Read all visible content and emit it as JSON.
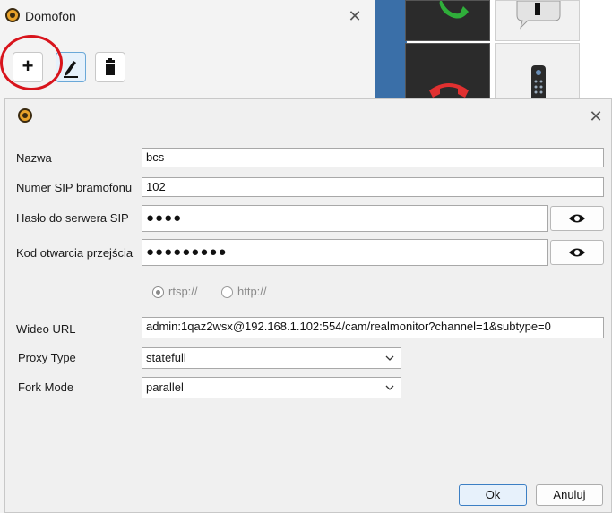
{
  "background_window": {
    "title": "Domofon",
    "close_glyph": "✕",
    "toolbar": {
      "add_glyph": "+",
      "add_icon": "plus-icon",
      "edit_icon": "pencil-icon",
      "delete_icon": "trash-icon"
    }
  },
  "side_tiles": {
    "icons": [
      "phone-answer-icon",
      "chat-bubble-icon",
      "phone-hangup-icon",
      "intercom-panel-icon"
    ]
  },
  "dialog": {
    "close_glyph": "✕",
    "fields": {
      "name_label": "Nazwa",
      "name_value": "bcs",
      "sip_label": "Numer SIP bramofonu",
      "sip_value": "102",
      "password_label": "Hasło do serwera SIP",
      "password_value": "●●●●",
      "code_label": "Kod otwarcia przejścia",
      "code_value": "●●●●●●●●●",
      "video_label": "Wideo URL",
      "video_value": "admin:1qaz2wsx@192.168.1.102:554/cam/realmonitor?channel=1&subtype=0",
      "proxy_label": "Proxy Type",
      "proxy_value": "statefull",
      "fork_label": "Fork Mode",
      "fork_value": "parallel"
    },
    "protocol": {
      "rtsp_label": "rtsp://",
      "http_label": "http://",
      "selected": "rtsp://"
    },
    "buttons": {
      "ok": "Ok",
      "cancel": "Anuluj"
    },
    "colors": {
      "accent": "#3c7fc4",
      "highlight_ring": "#d8141c"
    }
  }
}
